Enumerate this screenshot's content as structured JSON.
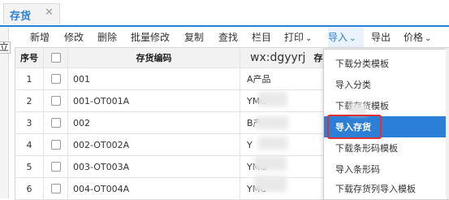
{
  "tab": {
    "label": "存货",
    "close": "✕"
  },
  "left_fragment": "立",
  "toolbar": {
    "items": [
      "新增",
      "修改",
      "删除",
      "批量修改",
      "复制",
      "查找",
      "栏目",
      "打印",
      "导入",
      "导出",
      "价格"
    ],
    "dropdown_caret": "⌄",
    "active": "导入"
  },
  "table": {
    "headers": {
      "seq": "序号",
      "code": "存货编码",
      "name_overlay": "wx:dgyyrj",
      "name": "存货名"
    },
    "rows": [
      {
        "seq": "1",
        "code": "001",
        "name": "A产品"
      },
      {
        "seq": "2",
        "code": "001-OT001A",
        "name": "YMC"
      },
      {
        "seq": "3",
        "code": "002",
        "name": "B产"
      },
      {
        "seq": "4",
        "code": "002-OT002A",
        "name": "Y"
      },
      {
        "seq": "5",
        "code": "003-OT003A",
        "name": "YMG"
      },
      {
        "seq": "6",
        "code": "004-OT004A",
        "name": "YMC"
      }
    ]
  },
  "dropdown": {
    "items": [
      "下载分类模板",
      "导入分类",
      "下载存货模板",
      "导入存货",
      "下载条形码模板",
      "导入条形码",
      "下载存货列导入模板"
    ],
    "highlighted": "导入存货"
  },
  "colors": {
    "accent": "#2b7fd6",
    "highlight_border": "#e23030"
  }
}
